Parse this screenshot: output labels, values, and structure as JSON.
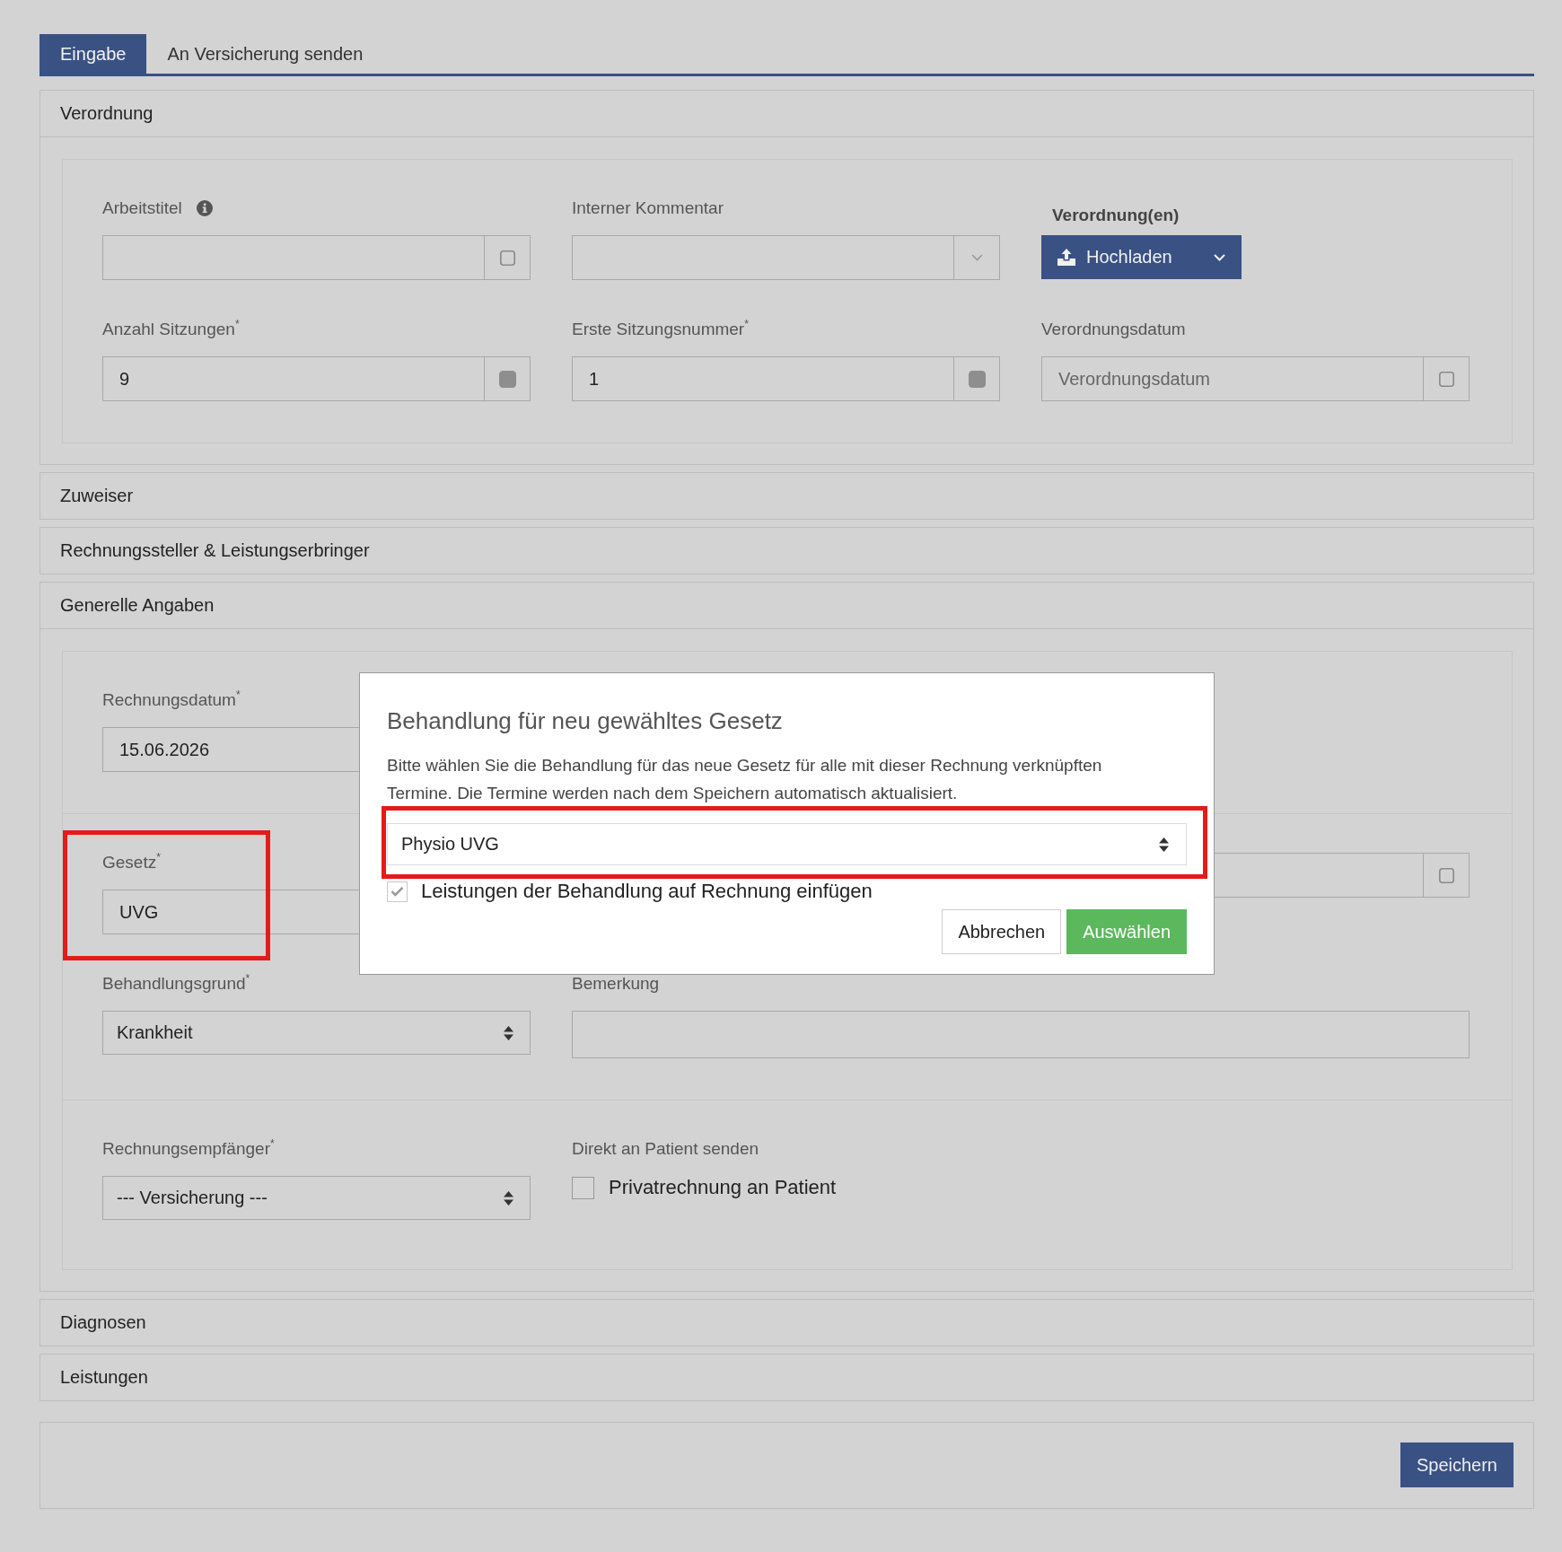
{
  "tabs": [
    {
      "label": "Eingabe",
      "selected": true
    },
    {
      "label": "An Versicherung senden",
      "selected": false
    }
  ],
  "sections": [
    {
      "title": "Verordnung",
      "expanded": true,
      "panels": [
        {
          "rows": [
            [
              {
                "kind": "square-input",
                "label": "Arbeitstitel",
                "info": true,
                "checked": false,
                "highlighted": false
              },
              {
                "kind": "combo",
                "label": "Interner Kommentar",
                "highlighted": false
              },
              {
                "kind": "upload",
                "label": "Verordnung(en)",
                "button": "Hochladen",
                "highlighted": false
              }
            ],
            [
              {
                "kind": "square-input",
                "label": "Anzahl Sitzungen$^{*}$",
                "value": "9",
                "checked": true,
                "highlighted": false
              },
              {
                "kind": "square-input",
                "label": "Erste Sitzungsnummer$^{*}$",
                "value": "1",
                "checked": true,
                "highlighted": false
              },
              {
                "kind": "square-input",
                "label": "Verordnungsdatum",
                "placeholder": "Verordnungsdatum",
                "checked": false,
                "highlighted": false
              }
            ]
          ]
        }
      ]
    },
    {
      "title": "Zuweiser",
      "expanded": false
    },
    {
      "title": "Rechnungssteller & Leistungserbringer",
      "expanded": false
    },
    {
      "title": "Generelle Angaben",
      "expanded": true,
      "panels": [
        {
          "rows": [
            [
              {
                "kind": "input",
                "label": "Rechnungsdatum$^{*}$",
                "value": "15.06.2026",
                "highlighted": false
              }
            ]
          ]
        },
        {
          "rows": [
            [
              {
                "kind": "input",
                "label": "Gesetz$^{*}$",
                "value": "UVG",
                "highlighted": true
              },
              {
                "kind": "square-input",
                "checked": false,
                "highlighted": false
              }
            ],
            [
              {
                "kind": "select",
                "label": "Behandlungsgrund$^{*}$",
                "value": "Krankheit",
                "highlighted": false
              },
              {
                "kind": "textarea",
                "label": "Bemerkung",
                "highlighted": false
              }
            ]
          ]
        },
        {
          "rows": [
            [
              {
                "kind": "select",
                "label": "Rechnungsempfänger$^{*}$",
                "value": "--- Versicherung ---",
                "highlighted": false
              },
              {
                "kind": "checkbox",
                "label": "Direkt an Patient senden",
                "option": "Privatrechnung an Patient",
                "checked": false,
                "highlighted": false
              }
            ]
          ]
        }
      ]
    },
    {
      "title": "Diagnosen",
      "expanded": false
    },
    {
      "title": "Leistungen",
      "expanded": false
    }
  ],
  "footer": {
    "save_button": "Speichern"
  },
  "modal": {
    "title": "Behandlung für neu gewähltes Gesetz",
    "text": "Bitte wählen Sie die Behandlung für das neue Gesetz für alle mit dieser Rechnung verknüpften Termine. Die Termine werden nach dem Speichern automatisch aktualisiert.",
    "select": {
      "value": "Physio UVG",
      "highlighted": true
    },
    "checkbox": {
      "label": "Leistungen der Behandlung auf Rechnung einfügen",
      "checked": true
    },
    "buttons": [
      {
        "label": "Abbrechen",
        "kind": "default"
      },
      {
        "label": "Auswählen",
        "kind": "primary"
      }
    ]
  }
}
